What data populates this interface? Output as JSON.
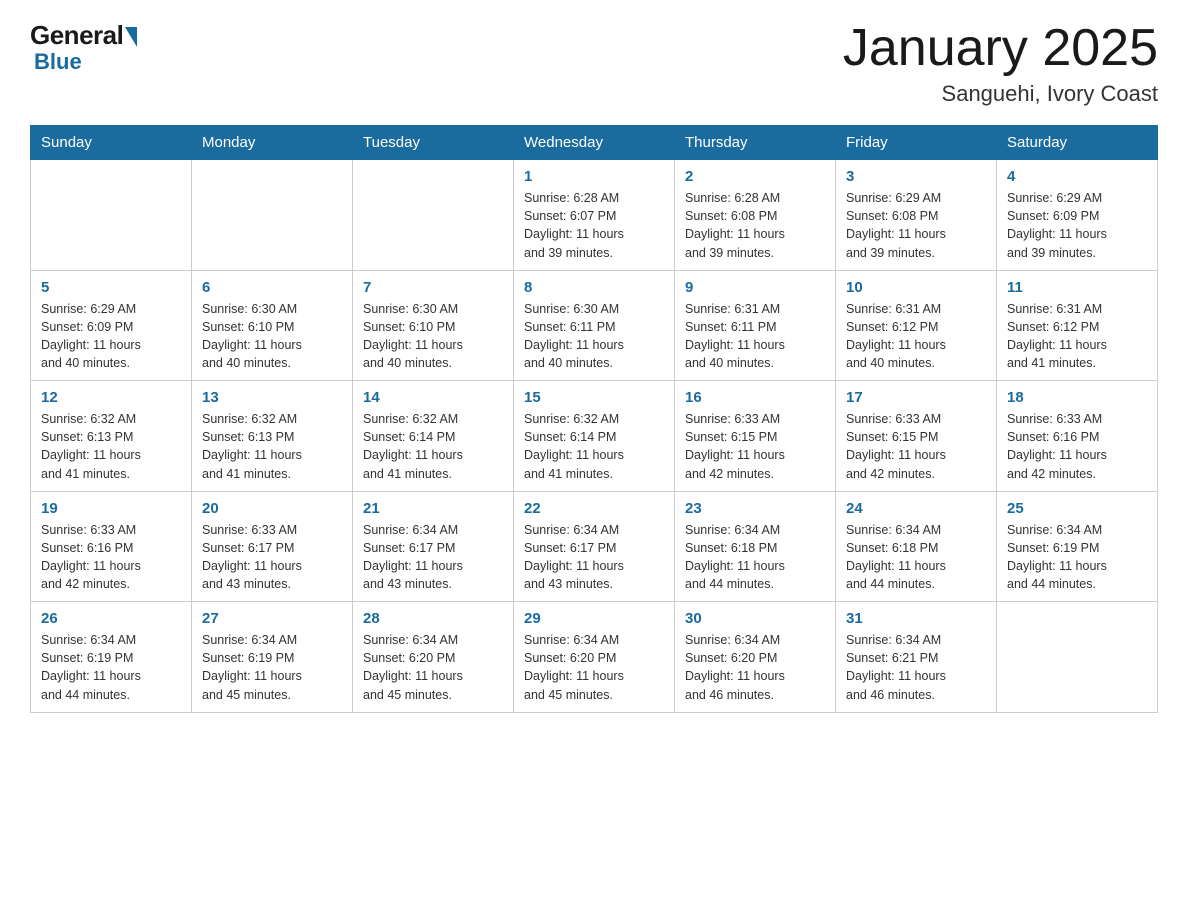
{
  "header": {
    "logo_general": "General",
    "logo_blue": "Blue",
    "month_title": "January 2025",
    "location": "Sanguehi, Ivory Coast"
  },
  "weekdays": [
    "Sunday",
    "Monday",
    "Tuesday",
    "Wednesday",
    "Thursday",
    "Friday",
    "Saturday"
  ],
  "weeks": [
    [
      {
        "day": "",
        "info": ""
      },
      {
        "day": "",
        "info": ""
      },
      {
        "day": "",
        "info": ""
      },
      {
        "day": "1",
        "info": "Sunrise: 6:28 AM\nSunset: 6:07 PM\nDaylight: 11 hours\nand 39 minutes."
      },
      {
        "day": "2",
        "info": "Sunrise: 6:28 AM\nSunset: 6:08 PM\nDaylight: 11 hours\nand 39 minutes."
      },
      {
        "day": "3",
        "info": "Sunrise: 6:29 AM\nSunset: 6:08 PM\nDaylight: 11 hours\nand 39 minutes."
      },
      {
        "day": "4",
        "info": "Sunrise: 6:29 AM\nSunset: 6:09 PM\nDaylight: 11 hours\nand 39 minutes."
      }
    ],
    [
      {
        "day": "5",
        "info": "Sunrise: 6:29 AM\nSunset: 6:09 PM\nDaylight: 11 hours\nand 40 minutes."
      },
      {
        "day": "6",
        "info": "Sunrise: 6:30 AM\nSunset: 6:10 PM\nDaylight: 11 hours\nand 40 minutes."
      },
      {
        "day": "7",
        "info": "Sunrise: 6:30 AM\nSunset: 6:10 PM\nDaylight: 11 hours\nand 40 minutes."
      },
      {
        "day": "8",
        "info": "Sunrise: 6:30 AM\nSunset: 6:11 PM\nDaylight: 11 hours\nand 40 minutes."
      },
      {
        "day": "9",
        "info": "Sunrise: 6:31 AM\nSunset: 6:11 PM\nDaylight: 11 hours\nand 40 minutes."
      },
      {
        "day": "10",
        "info": "Sunrise: 6:31 AM\nSunset: 6:12 PM\nDaylight: 11 hours\nand 40 minutes."
      },
      {
        "day": "11",
        "info": "Sunrise: 6:31 AM\nSunset: 6:12 PM\nDaylight: 11 hours\nand 41 minutes."
      }
    ],
    [
      {
        "day": "12",
        "info": "Sunrise: 6:32 AM\nSunset: 6:13 PM\nDaylight: 11 hours\nand 41 minutes."
      },
      {
        "day": "13",
        "info": "Sunrise: 6:32 AM\nSunset: 6:13 PM\nDaylight: 11 hours\nand 41 minutes."
      },
      {
        "day": "14",
        "info": "Sunrise: 6:32 AM\nSunset: 6:14 PM\nDaylight: 11 hours\nand 41 minutes."
      },
      {
        "day": "15",
        "info": "Sunrise: 6:32 AM\nSunset: 6:14 PM\nDaylight: 11 hours\nand 41 minutes."
      },
      {
        "day": "16",
        "info": "Sunrise: 6:33 AM\nSunset: 6:15 PM\nDaylight: 11 hours\nand 42 minutes."
      },
      {
        "day": "17",
        "info": "Sunrise: 6:33 AM\nSunset: 6:15 PM\nDaylight: 11 hours\nand 42 minutes."
      },
      {
        "day": "18",
        "info": "Sunrise: 6:33 AM\nSunset: 6:16 PM\nDaylight: 11 hours\nand 42 minutes."
      }
    ],
    [
      {
        "day": "19",
        "info": "Sunrise: 6:33 AM\nSunset: 6:16 PM\nDaylight: 11 hours\nand 42 minutes."
      },
      {
        "day": "20",
        "info": "Sunrise: 6:33 AM\nSunset: 6:17 PM\nDaylight: 11 hours\nand 43 minutes."
      },
      {
        "day": "21",
        "info": "Sunrise: 6:34 AM\nSunset: 6:17 PM\nDaylight: 11 hours\nand 43 minutes."
      },
      {
        "day": "22",
        "info": "Sunrise: 6:34 AM\nSunset: 6:17 PM\nDaylight: 11 hours\nand 43 minutes."
      },
      {
        "day": "23",
        "info": "Sunrise: 6:34 AM\nSunset: 6:18 PM\nDaylight: 11 hours\nand 44 minutes."
      },
      {
        "day": "24",
        "info": "Sunrise: 6:34 AM\nSunset: 6:18 PM\nDaylight: 11 hours\nand 44 minutes."
      },
      {
        "day": "25",
        "info": "Sunrise: 6:34 AM\nSunset: 6:19 PM\nDaylight: 11 hours\nand 44 minutes."
      }
    ],
    [
      {
        "day": "26",
        "info": "Sunrise: 6:34 AM\nSunset: 6:19 PM\nDaylight: 11 hours\nand 44 minutes."
      },
      {
        "day": "27",
        "info": "Sunrise: 6:34 AM\nSunset: 6:19 PM\nDaylight: 11 hours\nand 45 minutes."
      },
      {
        "day": "28",
        "info": "Sunrise: 6:34 AM\nSunset: 6:20 PM\nDaylight: 11 hours\nand 45 minutes."
      },
      {
        "day": "29",
        "info": "Sunrise: 6:34 AM\nSunset: 6:20 PM\nDaylight: 11 hours\nand 45 minutes."
      },
      {
        "day": "30",
        "info": "Sunrise: 6:34 AM\nSunset: 6:20 PM\nDaylight: 11 hours\nand 46 minutes."
      },
      {
        "day": "31",
        "info": "Sunrise: 6:34 AM\nSunset: 6:21 PM\nDaylight: 11 hours\nand 46 minutes."
      },
      {
        "day": "",
        "info": ""
      }
    ]
  ]
}
